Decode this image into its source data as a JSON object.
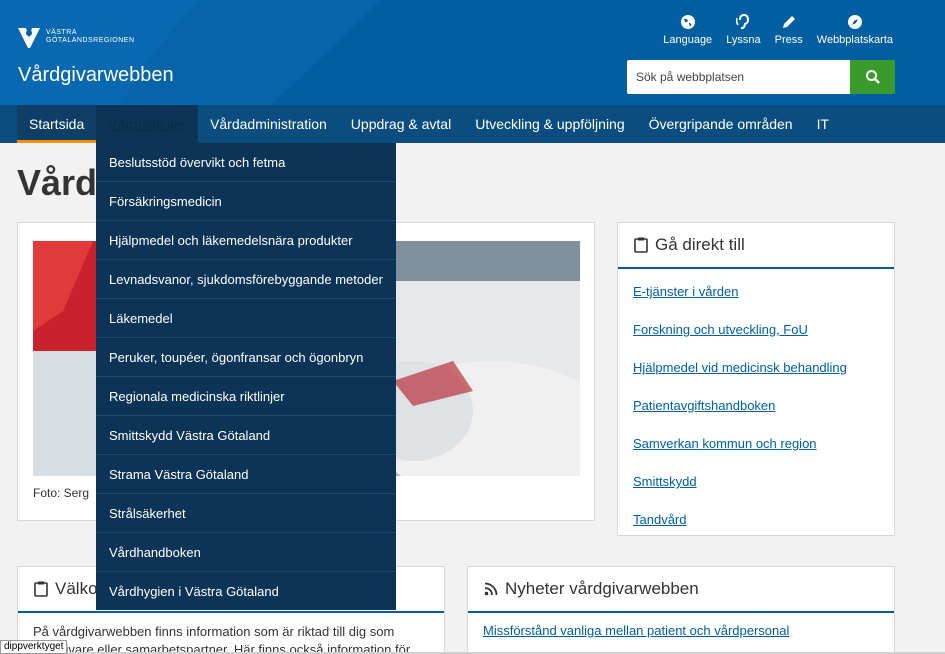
{
  "header": {
    "logo_text_line1": "VÄSTRA",
    "logo_text_line2": "GÖTALANDSREGIONEN",
    "site_title": "Vårdgivarwebben",
    "tools": [
      {
        "label": "Language",
        "icon": "globe-icon"
      },
      {
        "label": "Lyssna",
        "icon": "ear-icon"
      },
      {
        "label": "Press",
        "icon": "pencil-icon"
      },
      {
        "label": "Webbplatskarta",
        "icon": "compass-icon"
      }
    ],
    "search": {
      "placeholder": "Sök på webbplatsen",
      "value": ""
    }
  },
  "nav": {
    "items": [
      "Startsida",
      "Vårdriktlinjer",
      "Vårdadministration",
      "Uppdrag & avtal",
      "Utveckling & uppföljning",
      "Övergripande områden",
      "IT"
    ],
    "active": "Startsida",
    "open": "Vårdriktlinjer"
  },
  "dropdown": {
    "items": [
      "Beslutsstöd övervikt och fetma",
      "Försäkringsmedicin",
      "Hjälpmedel och läkemedelsnära produkter",
      "Levnadsvanor, sjukdomsförebyggande metoder",
      "Läkemedel",
      "Peruker, toupéer, ögonfransar och ögonbryn",
      "Regionala medicinska riktlinjer",
      "Smittskydd Västra Götaland",
      "Strama Västra Götaland",
      "Strålsäkerhet",
      "Vårdhandboken",
      "Vårdhygien i Västra Götaland"
    ]
  },
  "main": {
    "heading_visible": "Vårdg",
    "photo_caption": "Foto: Serg"
  },
  "direct": {
    "title": "Gå direkt till",
    "links": [
      "E-tjänster i vården",
      "Forskning och utveckling, FoU",
      "Hjälpmedel vid medicinsk behandling",
      "Patientavgiftshandboken",
      "Samverkan kommun och region",
      "Smittskydd",
      "Tandvård"
    ]
  },
  "welcome": {
    "title": "Välkommen",
    "title_visible": "Välko",
    "line1": "På vårdgivarwebben finns information som är riktad till dig som",
    "line2": "vårdgivare eller samarbetspartner. Här finns också information för"
  },
  "news": {
    "title": "Nyheter vårdgivarwebben",
    "first_link": "Missförstånd vanliga mellan patient och vårdpersonal"
  },
  "statusbar": {
    "text": "dippverktyget"
  },
  "colors": {
    "header_blue": "#005ea1",
    "nav_blue": "#0a4d7e",
    "dropdown_bg": "#0c3456",
    "search_green": "#3a9a2c",
    "active_orange": "#f29100"
  }
}
